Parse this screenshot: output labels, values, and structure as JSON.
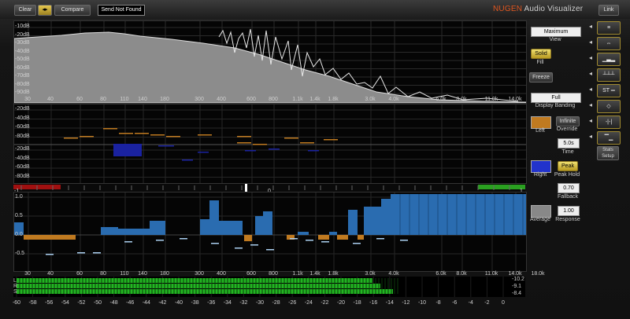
{
  "toolbar": {
    "clear_label": "Clear",
    "swap_label": "◂▸",
    "compare_label": "Compare",
    "status_text": "Send Not Found",
    "brand_prefix": "NU",
    "brand_mid": "GEN",
    "brand_suffix": " Audio Visualizer",
    "link_label": "Link"
  },
  "spectrum": {
    "db_labels": [
      "-10dB",
      "-20dB",
      "-30dB",
      "-40dB",
      "-50dB",
      "-60dB",
      "-70dB",
      "-80dB",
      "-90dB"
    ],
    "freq_labels": [
      "30",
      "40",
      "60",
      "80",
      "110",
      "140",
      "180",
      "300",
      "400",
      "600",
      "800",
      "1.1k",
      "1.4k",
      "1.8k",
      "3.0k",
      "4.0k",
      "6.0k",
      "8.0k",
      "11.0k",
      "14.0k",
      "18.0k"
    ]
  },
  "banding": {
    "db_labels": [
      "-20dB",
      "-40dB",
      "-60dB",
      "-80dB",
      "-20dB",
      "-40dB",
      "-60dB",
      "-80dB"
    ]
  },
  "correlation": {
    "scale_left": "-1",
    "scale_center": "0",
    "scale_right": "1",
    "y_labels": [
      "1.0",
      "0.5",
      "0.0",
      "-0.5"
    ]
  },
  "meters": {
    "row_labels": [
      "L",
      "R",
      "S"
    ],
    "db_scale": [
      "-60",
      "-58",
      "-56",
      "-54",
      "-52",
      "-50",
      "-48",
      "-46",
      "-44",
      "-42",
      "-40",
      "-38",
      "-36",
      "-34",
      "-32",
      "-30",
      "-28",
      "-26",
      "-24",
      "-22",
      "-20",
      "-18",
      "-16",
      "-14",
      "-12",
      "-10",
      "-8",
      "-6",
      "-4",
      "-2",
      "0"
    ],
    "values": [
      "-10.2",
      "-9.1",
      "-8.4"
    ]
  },
  "side": {
    "view_value": "Maximum",
    "view_label": "View",
    "fill_button": "Solid",
    "fill_label": "Fill",
    "freeze_button": "Freeze",
    "banding_value": "Full",
    "banding_label": "Display Banding",
    "left_label": "Left",
    "override_button": "Infinite",
    "override_label": "Override",
    "time_value": "5.0s",
    "time_label": "Time",
    "right_label": "Right",
    "peakhold_button": "Peak",
    "peakhold_label": "Peak Hold",
    "fallback_value": "0.70",
    "fallback_label": "Fallback",
    "average_label": "Average",
    "response_value": "1.00",
    "response_label": "Response",
    "left_color": "#c07a20",
    "right_color": "#2233cc",
    "average_color": "#888888"
  },
  "iconbar": {
    "stats_label": "Stats Setup",
    "icons": [
      "waveform-lines-icon",
      "stereo-width-icon",
      "spectrum-fill-icon",
      "banding-icon",
      "st-icon",
      "diamond-icon",
      "phase-icon",
      "fallback-icon"
    ],
    "st_label": "ST"
  }
}
